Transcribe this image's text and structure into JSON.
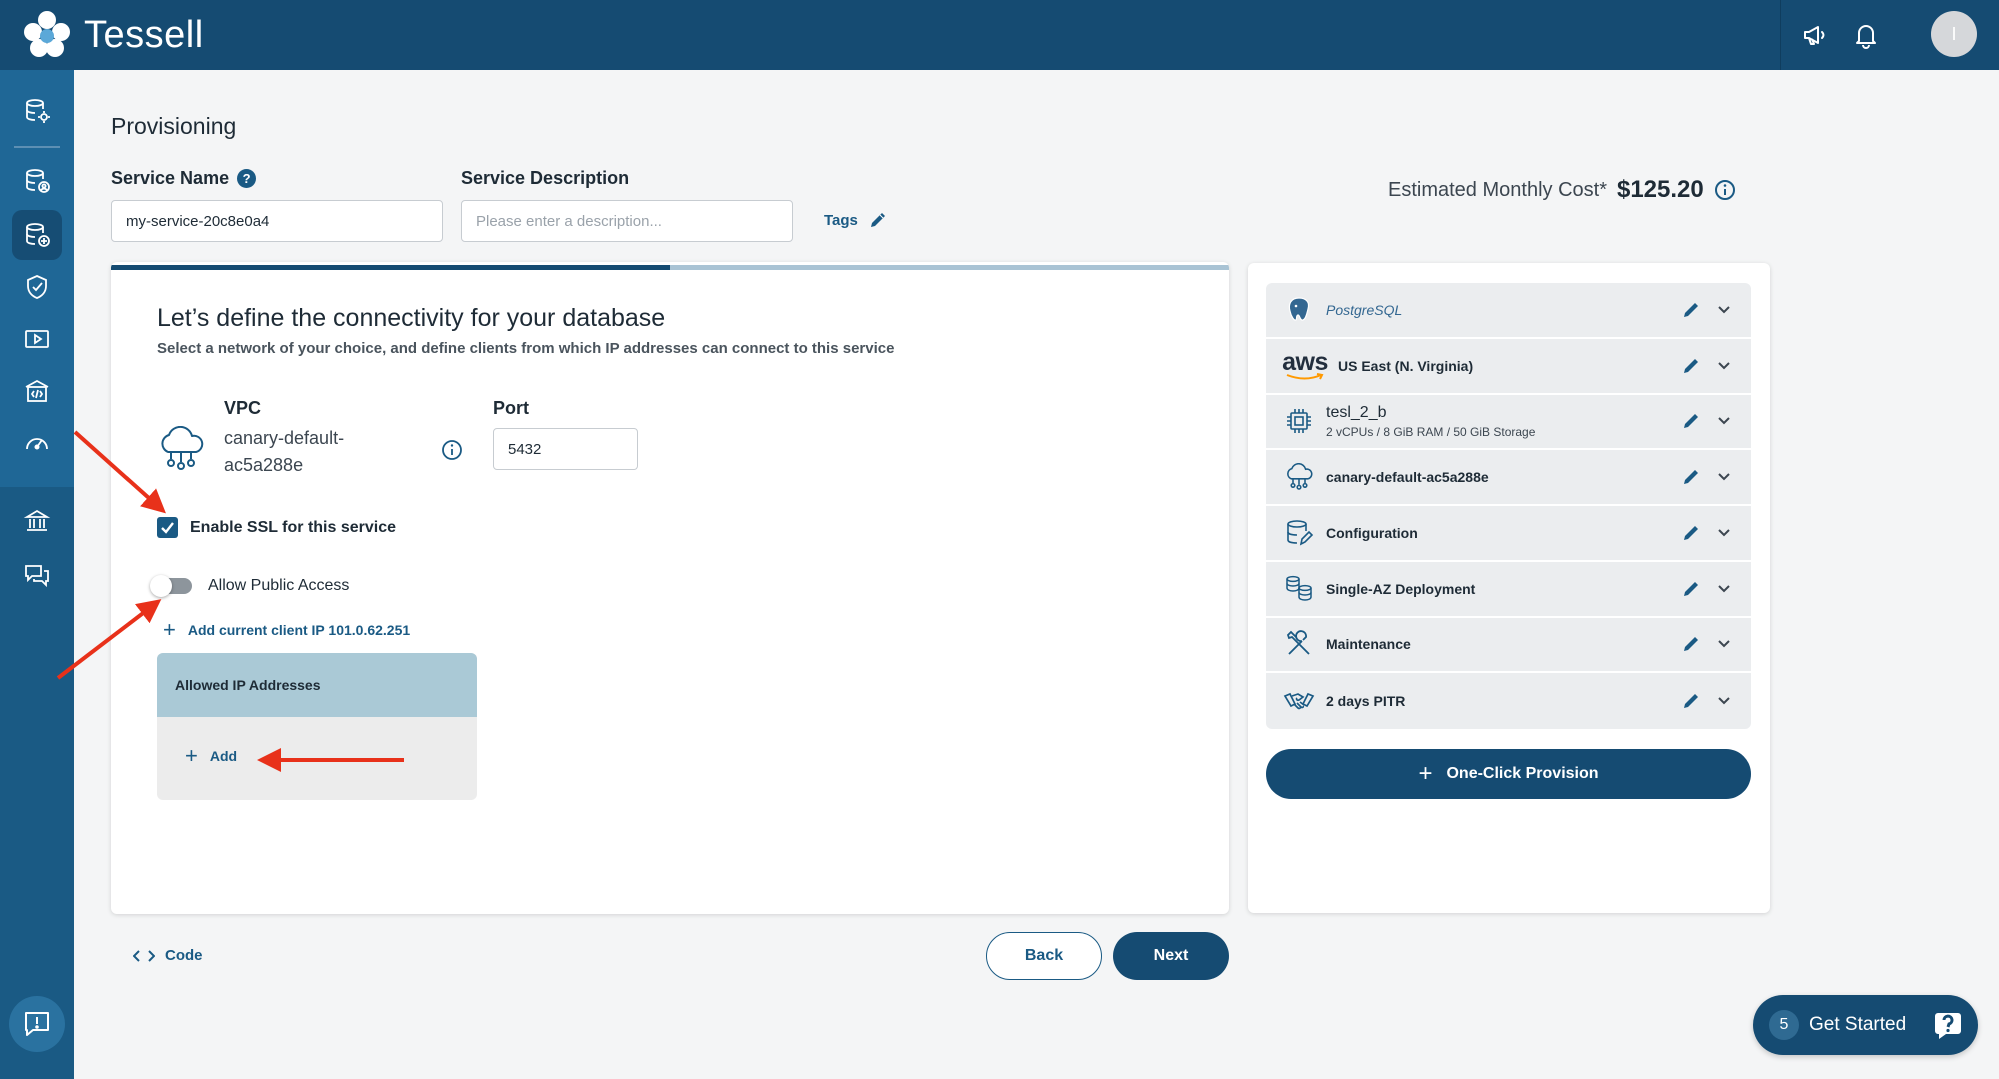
{
  "app": {
    "name": "Tessell",
    "avatar_initial": "I"
  },
  "header": {
    "icons": [
      "megaphone-icon",
      "bell-icon"
    ]
  },
  "sidebar": {
    "items": [
      "database-settings-icon",
      "database-user-icon",
      "database-add-icon",
      "shield-icon",
      "video-icon",
      "code-building-icon",
      "speedometer-icon",
      "bank-icon",
      "chat-icon"
    ],
    "active_index": 2
  },
  "page": {
    "title": "Provisioning"
  },
  "service_form": {
    "name_label": "Service Name",
    "name_value": "my-service-20c8e0a4",
    "description_label": "Service Description",
    "description_placeholder": "Please enter a description...",
    "tags_label": "Tags"
  },
  "cost": {
    "label": "Estimated Monthly Cost*",
    "value": "$125.20"
  },
  "wizard": {
    "progress": 0.5,
    "heading": "Let’s define the connectivity for your database",
    "subheading": "Select a network of your choice, and define clients from which IP addresses can connect to this service",
    "vpc_label": "VPC",
    "vpc_value": "canary-default-ac5a288e",
    "port_label": "Port",
    "port_value": "5432",
    "ssl_label": "Enable SSL for this service",
    "ssl_checked": true,
    "public_access_label": "Allow Public Access",
    "public_access_on": false,
    "add_client_ip_label": "Add current client IP 101.0.62.251",
    "allowed_ip_header": "Allowed IP Addresses",
    "add_label": "Add"
  },
  "footer": {
    "code_label": "Code",
    "back_label": "Back",
    "next_label": "Next"
  },
  "summary": {
    "rows": [
      {
        "icon": "postgresql-icon",
        "title": "PostgreSQL",
        "subtitle": ""
      },
      {
        "icon": "aws-icon",
        "icon_text": "aws",
        "title": "US East (N. Virginia)",
        "subtitle": ""
      },
      {
        "icon": "cpu-icon",
        "title": "tesl_2_b",
        "subtitle": "2 vCPUs / 8 GiB RAM / 50 GiB Storage"
      },
      {
        "icon": "cloud-network-icon",
        "title": "canary-default-ac5a288e",
        "subtitle": ""
      },
      {
        "icon": "database-config-icon",
        "title": "Configuration",
        "subtitle": ""
      },
      {
        "icon": "database-deployment-icon",
        "title": "Single-AZ Deployment",
        "subtitle": ""
      },
      {
        "icon": "tools-icon",
        "title": "Maintenance",
        "subtitle": ""
      },
      {
        "icon": "handshake-icon",
        "title": "2 days PITR",
        "subtitle": ""
      }
    ],
    "provision_label": "One-Click Provision"
  },
  "get_started": {
    "count": "5",
    "label": "Get Started"
  },
  "colors": {
    "brand": "#154b72",
    "accent": "#1a5a84",
    "annotation": "#e8311a"
  }
}
